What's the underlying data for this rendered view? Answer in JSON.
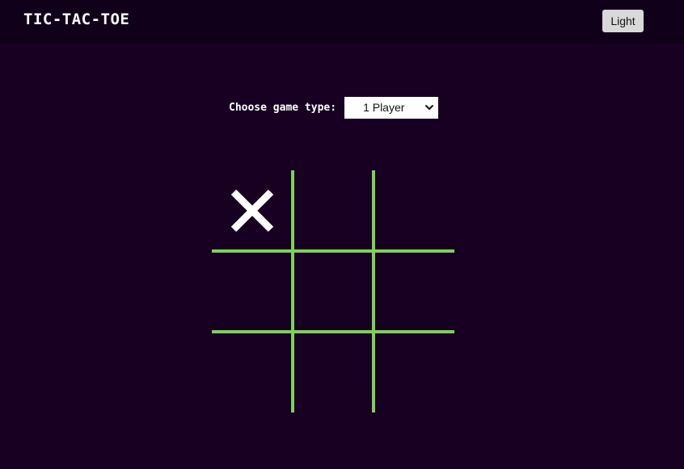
{
  "header": {
    "title": "TIC-TAC-TOE",
    "theme_button_label": "Light"
  },
  "controls": {
    "game_type_label": "Choose game type:",
    "game_type_selected": "1 Player"
  },
  "board": {
    "cells": [
      "X",
      "",
      "",
      "",
      "",
      "",
      "",
      "",
      ""
    ],
    "line_color": "#7ed05a",
    "mark_color": "#ffffff"
  },
  "colors": {
    "background": "#170021",
    "header_background": "#11001a"
  }
}
